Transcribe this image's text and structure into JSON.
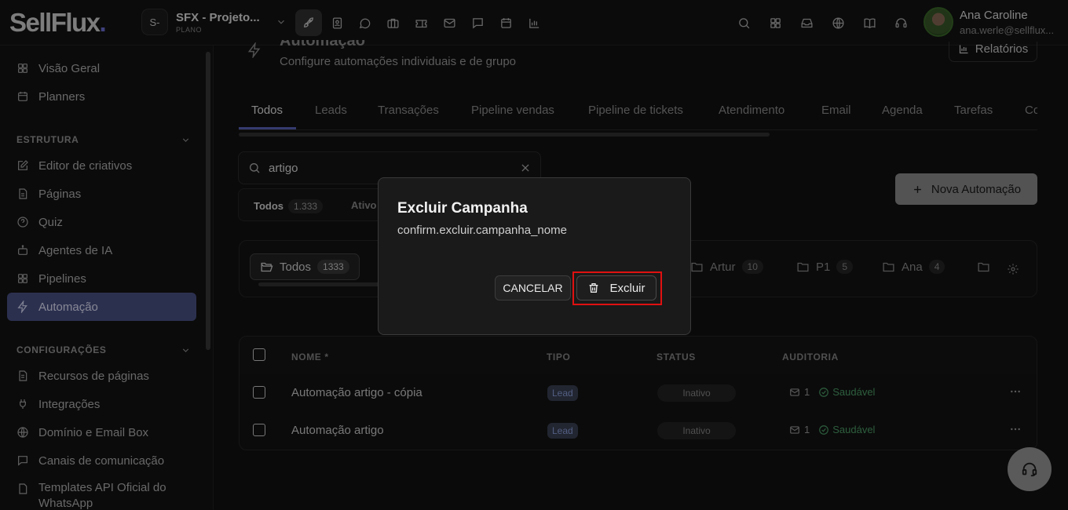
{
  "app": {
    "logo_text": "SellFlux",
    "logo_dot": "."
  },
  "project": {
    "initials": "S-",
    "name": "SFX - Projeto...",
    "plan": "PLANO"
  },
  "topbar_icons": [
    "rocket-icon",
    "contact-card-icon",
    "chat-bubble-icon",
    "briefcase-icon",
    "ticket-icon",
    "mail-icon",
    "message-square-icon",
    "calendar-icon",
    "bar-chart-icon"
  ],
  "topbar_right_icons": [
    "search-icon",
    "grid-icon",
    "inbox-icon",
    "globe-icon",
    "book-icon",
    "headset-icon"
  ],
  "user": {
    "name": "Ana Caroline",
    "email": "ana.werle@sellflux..."
  },
  "sidebar": {
    "top_items": [
      {
        "label": "Visão Geral",
        "icon": "dashboard-icon"
      },
      {
        "label": "Planners",
        "icon": "calendar-icon"
      }
    ],
    "sections": [
      {
        "title": "ESTRUTURA",
        "items": [
          {
            "label": "Editor de criativos",
            "icon": "edit-icon"
          },
          {
            "label": "Páginas",
            "icon": "file-icon"
          },
          {
            "label": "Quiz",
            "icon": "question-icon"
          },
          {
            "label": "Agentes de IA",
            "icon": "bot-icon"
          },
          {
            "label": "Pipelines",
            "icon": "kanban-icon"
          },
          {
            "label": "Automação",
            "icon": "zap-icon",
            "active": true
          }
        ]
      },
      {
        "title": "CONFIGURAÇÕES",
        "items": [
          {
            "label": "Recursos de páginas",
            "icon": "file-list-icon"
          },
          {
            "label": "Integrações",
            "icon": "plug-icon"
          },
          {
            "label": "Domínio e Email Box",
            "icon": "globe-icon"
          },
          {
            "label": "Canais de comunicação",
            "icon": "chat-icon"
          },
          {
            "label": "Templates API Oficial do WhatsApp",
            "icon": "file-icon"
          }
        ]
      }
    ]
  },
  "page": {
    "title": "Automação",
    "subtitle": "Configure automações individuais e de grupo",
    "reports_label": "Relatórios"
  },
  "tabs": [
    "Todos",
    "Leads",
    "Transações",
    "Pipeline vendas",
    "Pipeline de tickets",
    "Atendimento",
    "Email",
    "Agenda",
    "Tarefas",
    "Co"
  ],
  "search": {
    "value": "artigo"
  },
  "status_filter": [
    {
      "label": "Todos",
      "count": "1.333"
    },
    {
      "label": "Ativo",
      "count": ""
    }
  ],
  "new_automation_label": "Nova Automação",
  "folders": [
    {
      "label": "Todos",
      "count": "1333",
      "active": true
    },
    {
      "label": "Artur",
      "count": "10"
    },
    {
      "label": "P1",
      "count": "5"
    },
    {
      "label": "Ana",
      "count": "4"
    },
    {
      "label": "",
      "count": ""
    }
  ],
  "table": {
    "headers": {
      "name": "NOME *",
      "type": "TIPO",
      "status": "STATUS",
      "audit": "AUDITORIA"
    },
    "rows": [
      {
        "name": "Automação artigo - cópia",
        "type": "Lead",
        "status": "Inativo",
        "audit_count": "1",
        "health": "Saudável"
      },
      {
        "name": "Automação artigo",
        "type": "Lead",
        "status": "Inativo",
        "audit_count": "1",
        "health": "Saudável"
      }
    ]
  },
  "modal": {
    "title": "Excluir Campanha",
    "message": "confirm.excluir.campanha_nome",
    "cancel_label": "CANCELAR",
    "delete_label": "Excluir"
  },
  "colors": {
    "accent": "#5c65c0",
    "active_nav": "#4c5488",
    "highlight": "#e01010",
    "success": "#4fa36b"
  }
}
